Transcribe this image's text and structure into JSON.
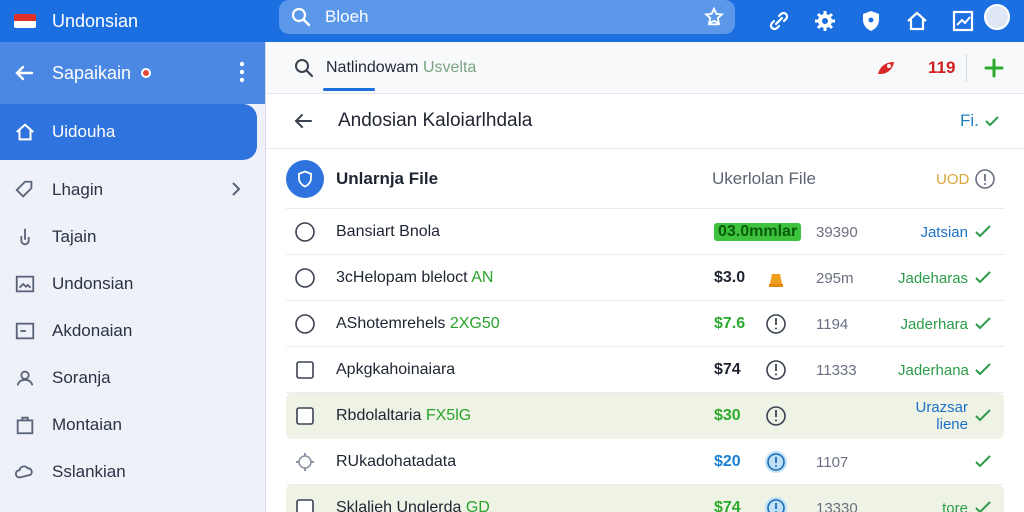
{
  "app": {
    "title": "Undonsian",
    "search_text": "Bloeh"
  },
  "sidebar": {
    "header": "Sapaikain",
    "active": "Uidouha",
    "items": [
      {
        "label": "Lhagin",
        "icon": "tag-icon",
        "chevron": true
      },
      {
        "label": "Tajain",
        "icon": "hand-icon"
      },
      {
        "label": "Undonsian",
        "icon": "image-icon"
      },
      {
        "label": "Akdonaian",
        "icon": "square-icon"
      },
      {
        "label": "Soranja",
        "icon": "users-icon"
      },
      {
        "label": "Montaian",
        "icon": "bag-icon"
      },
      {
        "label": "Sslankian",
        "icon": "cloud-icon"
      }
    ]
  },
  "subbar": {
    "query_main": "Natlindowam",
    "query_light": "Usvelta",
    "count": "119"
  },
  "title": {
    "text": "Andosian Kaloiarlhdala",
    "filter": "Fi."
  },
  "table": {
    "header": {
      "name": "Unlarnja File",
      "col": "Ukerlolan File",
      "badge": "UOD"
    },
    "rows": [
      {
        "control": "radio",
        "name": "Bansiart Bnola",
        "name_hl": "",
        "amount": "03.0mmlar",
        "amount_style": "pill",
        "icon": "",
        "num": "39390",
        "status": "Jatsian",
        "status_color": "blue"
      },
      {
        "control": "radio",
        "name": "3cHelopam bleloct",
        "name_hl": "AN",
        "amount": "$3.0",
        "amount_style": "dark",
        "icon": "bell-icon",
        "num": "295m",
        "status": "Jadeharas",
        "status_color": "green"
      },
      {
        "control": "radio",
        "name": "AShotemrehels",
        "name_hl": "2XG50",
        "amount": "$7.6",
        "amount_style": "green",
        "icon": "clock-icon",
        "num": "1194",
        "status": "Jaderhara",
        "status_color": "green"
      },
      {
        "control": "checkbox",
        "name": "Apkgkahoinaiara",
        "name_hl": "",
        "amount": "$74",
        "amount_style": "dark",
        "icon": "clock-icon",
        "num": "11333",
        "status": "Jaderhana",
        "status_color": "green"
      },
      {
        "control": "checkbox",
        "name": "Rbdolaltaria",
        "name_hl": "FX5lG",
        "amount": "$30",
        "amount_style": "green",
        "icon": "clock-icon",
        "num": "",
        "status": "Urazsar  liene",
        "status_color": "blue",
        "highlight": true
      },
      {
        "control": "gear",
        "name": "RUkadohatadata",
        "name_hl": "",
        "amount": "$20",
        "amount_style": "blue",
        "icon": "clock-blue-icon",
        "num": "1107",
        "status": "",
        "status_color": "green"
      },
      {
        "control": "checkbox",
        "name": "Sklalieh Unglerda",
        "name_hl": "GD",
        "amount": "$74",
        "amount_style": "green",
        "icon": "clock-blue-icon",
        "num": "13330",
        "status": "tore",
        "status_color": "green",
        "highlight": true
      }
    ]
  },
  "colors": {
    "primary": "#1b6fe0",
    "sidebar_active": "#2f73de",
    "green": "#2caa2c",
    "red": "#d02020"
  }
}
